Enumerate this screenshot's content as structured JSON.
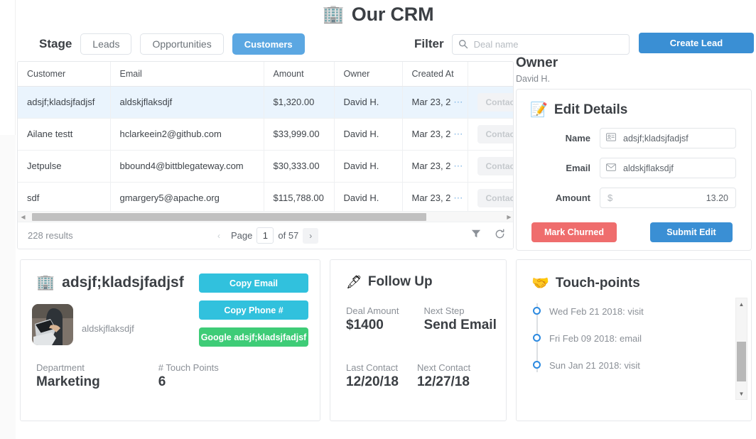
{
  "header": {
    "logo_icon": "office-building-icon",
    "logo_glyph": "🏢",
    "title": "Our CRM"
  },
  "toolbar": {
    "stage_label": "Stage",
    "stages": [
      {
        "label": "Leads",
        "active": false
      },
      {
        "label": "Opportunities",
        "active": false
      },
      {
        "label": "Customers",
        "active": true
      }
    ],
    "filter_label": "Filter",
    "search_placeholder": "Deal name",
    "search_value": "",
    "create_label": "Create Lead"
  },
  "table": {
    "columns": [
      "Customer",
      "Email",
      "Amount",
      "Owner",
      "Created At",
      ""
    ],
    "rows": [
      {
        "customer": "adsjf;kladsjfadjsf",
        "email": "aldskjflaksdjf",
        "amount": "$1,320.00",
        "owner": "David H.",
        "created": "Mar 23, 2",
        "action": "Contact",
        "selected": true
      },
      {
        "customer": "Ailane testt",
        "email": "hclarkeein2@github.com",
        "amount": "$33,999.00",
        "owner": "David H.",
        "created": "Mar 23, 2",
        "action": "Contact",
        "selected": false
      },
      {
        "customer": "Jetpulse",
        "email": "bbound4@bittblegateway.com",
        "amount": "$30,333.00",
        "owner": "David H.",
        "created": "Mar 23, 2",
        "action": "Contact",
        "selected": false
      },
      {
        "customer": "sdf",
        "email": "gmargery5@apache.org",
        "amount": "$115,788.00",
        "owner": "David H.",
        "created": "Mar 23, 2",
        "action": "Contact",
        "selected": false
      }
    ],
    "footer": {
      "results": "228 results",
      "page_word": "Page",
      "page_value": "1",
      "of_text": "of 57",
      "prev_glyph": "‹",
      "next_glyph": "›"
    }
  },
  "owner": {
    "title": "Owner",
    "name": "David H."
  },
  "edit": {
    "icon": "memo-icon",
    "icon_glyph": "📝",
    "title": "Edit Details",
    "fields": [
      {
        "label": "Name",
        "value": "adsjf;kladsjfadjsf",
        "icon": "id-card-icon"
      },
      {
        "label": "Email",
        "value": "aldskjflaksdjf",
        "icon": "envelope-icon"
      },
      {
        "label": "Amount",
        "value": "13.20",
        "prefix": "$",
        "icon": "dollar-icon"
      }
    ],
    "churn_label": "Mark Churned",
    "submit_label": "Submit Edit"
  },
  "customer_card": {
    "icon": "office-building-icon",
    "icon_glyph": "🏢",
    "name": "adsjf;kladsjfadjsf",
    "subtitle": "aldskjflaksdjf",
    "avatar_alt": "person-at-laptop-photo",
    "buttons": [
      {
        "label": "Copy Email",
        "style": "cyan"
      },
      {
        "label": "Copy Phone #",
        "style": "cyan"
      },
      {
        "label": "Google adsjf;kladsjfadjsf",
        "style": "green"
      }
    ],
    "stats": [
      {
        "label": "Department",
        "value": "Marketing"
      },
      {
        "label": "# Touch Points",
        "value": "6"
      }
    ]
  },
  "followup": {
    "icon": "pen-icon",
    "icon_glyph": "🖋",
    "title": "Follow Up",
    "stats_top": [
      {
        "label": "Deal Amount",
        "value": "$1400"
      },
      {
        "label": "Next Step",
        "value": "Send Email"
      }
    ],
    "stats_bottom": [
      {
        "label": "Last Contact",
        "value": "12/20/18"
      },
      {
        "label": "Next Contact",
        "value": "12/27/18"
      }
    ]
  },
  "touchpoints": {
    "icon": "handshake-icon",
    "icon_glyph": "🤝",
    "title": "Touch-points",
    "items": [
      "Wed Feb 21 2018: visit",
      "Fri Feb 09 2018: email",
      "Sun Jan 21 2018: visit"
    ]
  },
  "colors": {
    "primary_blue": "#3a8fd4",
    "stage_blue": "#5ba7e2",
    "cyan": "#31c1dd",
    "green": "#3ecc77",
    "red": "#ef6d6d",
    "row_selected": "#eaf4fd"
  }
}
